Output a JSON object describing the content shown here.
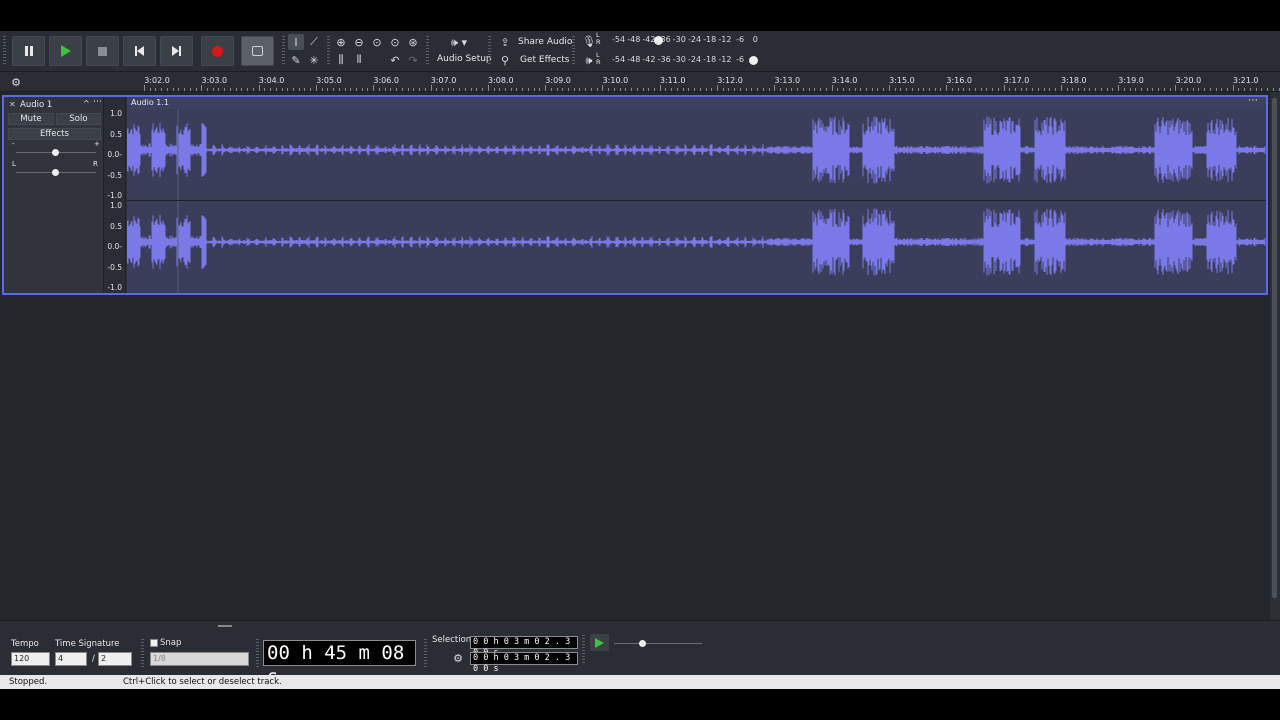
{
  "toolbar": {
    "audio_setup": "Audio Setup",
    "share_audio": "Share Audio",
    "get_effects": "Get Effects",
    "meter_ticks": [
      "-54",
      "-48",
      "-42",
      "-36",
      "-30",
      "-24",
      "-18",
      "-12",
      "-6",
      "0"
    ],
    "meter_ticks_play": [
      "-54",
      "-48",
      "-42",
      "-36",
      "-30",
      "-24",
      "-18",
      "-12",
      "-6"
    ],
    "rec_meter_level": "-42",
    "meter_lr": [
      "L",
      "R"
    ]
  },
  "ruler": {
    "ticks": [
      "3:02.0",
      "3:03.0",
      "3:04.0",
      "3:05.0",
      "3:06.0",
      "3:07.0",
      "3:08.0",
      "3:09.0",
      "3:10.0",
      "3:11.0",
      "3:12.0",
      "3:13.0",
      "3:14.0",
      "3:15.0",
      "3:16.0",
      "3:17.0",
      "3:18.0",
      "3:19.0",
      "3:20.0",
      "3:21.0"
    ]
  },
  "track": {
    "name": "Audio 1",
    "mute": "Mute",
    "solo": "Solo",
    "effects": "Effects",
    "gain_minus": "-",
    "gain_plus": "+",
    "pan_left": "L",
    "pan_right": "R",
    "gain_level": 0.5,
    "pan_level": 0.5,
    "clip_name": "Audio 1.1",
    "scale_labels": [
      "1.0",
      "0.5",
      "0.0-",
      "-0.5",
      "-1.0"
    ]
  },
  "bottom": {
    "tempo_label": "Tempo",
    "tempo_value": "120",
    "time_sig_label": "Time Signature",
    "time_sig_num": "4",
    "time_sig_sep": "/",
    "time_sig_den": "2",
    "snap_label": "Snap",
    "snap_value": "1/8",
    "time_display": "00 h 45 m 08 s",
    "selection_label": "Selection",
    "selection_start": "0 0 h 0 3 m 0 2 . 3 0 0 s",
    "selection_end": "0 0 h 0 3 m 0 2 . 3 0 0 s"
  },
  "status": {
    "state": "Stopped.",
    "hint": "Ctrl+Click to select or deselect track."
  },
  "colors": {
    "waveform": "#7b78e8",
    "selection_border": "#5a6ae6",
    "record": "#d81818",
    "play": "#3cc23c"
  }
}
